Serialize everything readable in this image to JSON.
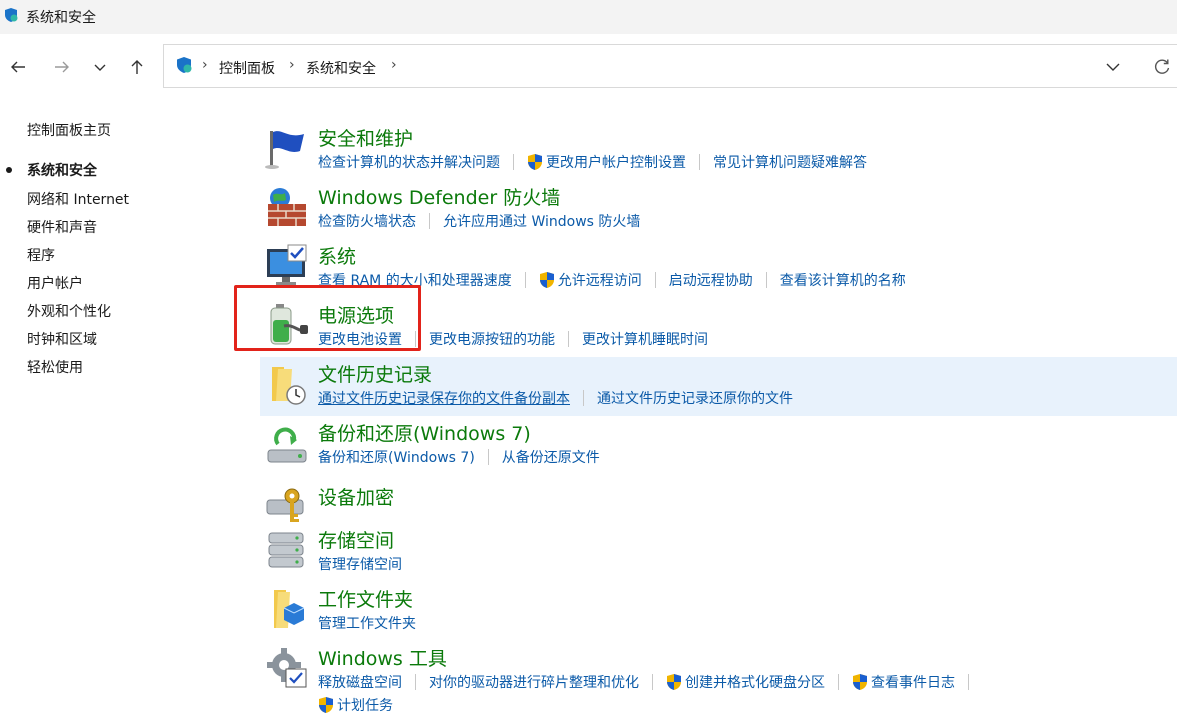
{
  "window": {
    "title": "系统和安全"
  },
  "breadcrumb": [
    "控制面板",
    "系统和安全"
  ],
  "sidebar": {
    "items": [
      {
        "label": "控制面板主页",
        "current": false
      },
      {
        "label": "系统和安全",
        "current": true
      },
      {
        "label": "网络和 Internet",
        "current": false
      },
      {
        "label": "硬件和声音",
        "current": false
      },
      {
        "label": "程序",
        "current": false
      },
      {
        "label": "用户帐户",
        "current": false
      },
      {
        "label": "外观和个性化",
        "current": false
      },
      {
        "label": "时钟和区域",
        "current": false
      },
      {
        "label": "轻松使用",
        "current": false
      }
    ]
  },
  "categories": [
    {
      "title": "安全和维护",
      "links": [
        "检查计算机的状态并解决问题",
        "更改用户帐户控制设置",
        "常见计算机问题疑难解答"
      ]
    },
    {
      "title": "Windows Defender 防火墙",
      "links": [
        "检查防火墙状态",
        "允许应用通过 Windows 防火墙"
      ]
    },
    {
      "title": "系统",
      "links": [
        "查看 RAM 的大小和处理器速度",
        "允许远程访问",
        "启动远程协助",
        "查看该计算机的名称"
      ]
    },
    {
      "title": "电源选项",
      "links": [
        "更改电池设置",
        "更改电源按钮的功能",
        "更改计算机睡眠时间"
      ]
    },
    {
      "title": "文件历史记录",
      "links": [
        "通过文件历史记录保存你的文件备份副本",
        "通过文件历史记录还原你的文件"
      ]
    },
    {
      "title": "备份和还原(Windows 7)",
      "links": [
        "备份和还原(Windows 7)",
        "从备份还原文件"
      ]
    },
    {
      "title": "设备加密",
      "links": []
    },
    {
      "title": "存储空间",
      "links": [
        "管理存储空间"
      ]
    },
    {
      "title": "工作文件夹",
      "links": [
        "管理工作文件夹"
      ]
    },
    {
      "title": "Windows 工具",
      "links": [
        "释放磁盘空间",
        "对你的驱动器进行碎片整理和优化",
        "创建并格式化硬盘分区",
        "查看事件日志",
        "计划任务"
      ]
    }
  ],
  "colors": {
    "category_title": "#0b7a0b",
    "link": "#0b5aa8",
    "highlight_box": "#e2231a",
    "hover_row": "#e8f2fc"
  }
}
